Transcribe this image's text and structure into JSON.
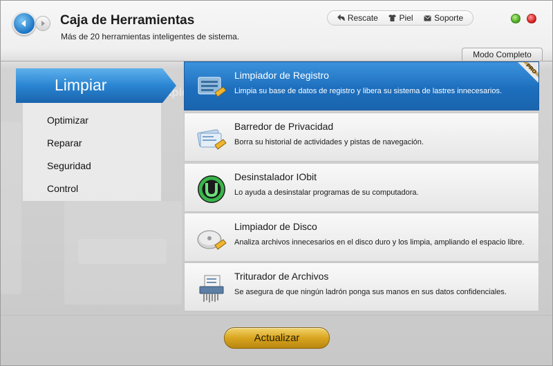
{
  "header": {
    "title": "Caja de Herramientas",
    "subtitle": "Más de 20 herramientas inteligentes de sistema.",
    "links": [
      {
        "label": "Rescate",
        "icon": "rescue-arrow-icon"
      },
      {
        "label": "Piel",
        "icon": "shirt-icon"
      },
      {
        "label": "Soporte",
        "icon": "mail-icon"
      }
    ],
    "mode_tab": "Modo Completo"
  },
  "menu": {
    "active": "Limpiar",
    "items": [
      "Optimizar",
      "Reparar",
      "Seguridad",
      "Control"
    ]
  },
  "tools": [
    {
      "title": "Limpiador de Registro",
      "desc": "Limpia su base de datos de registro y libera su sistema de lastres innecesarios.",
      "icon": "registry-cleaner-icon",
      "badge": "PRO"
    },
    {
      "title": "Barredor de Privacidad",
      "desc": "Borra su historial de actividades y pistas de navegación.",
      "icon": "privacy-sweeper-icon"
    },
    {
      "title": "Desinstalador IObit",
      "desc": "Lo ayuda a desinstalar programas de su computadora.",
      "icon": "iobit-uninstaller-icon"
    },
    {
      "title": "Limpiador de Disco",
      "desc": "Analiza archivos innecesarios en el disco duro y los limpia, ampliando el espacio libre.",
      "icon": "disk-cleaner-icon"
    },
    {
      "title": "Triturador de Archivos",
      "desc": "Se asegura de que ningún ladrón ponga sus manos en sus datos confidenciales.",
      "icon": "file-shredder-icon"
    }
  ],
  "footer": {
    "update_label": "Actualizar"
  },
  "colors": {
    "accent": "#1d6fbe",
    "update_button": "#d9a520",
    "window_min": "#3ea316",
    "window_close": "#d31515"
  }
}
